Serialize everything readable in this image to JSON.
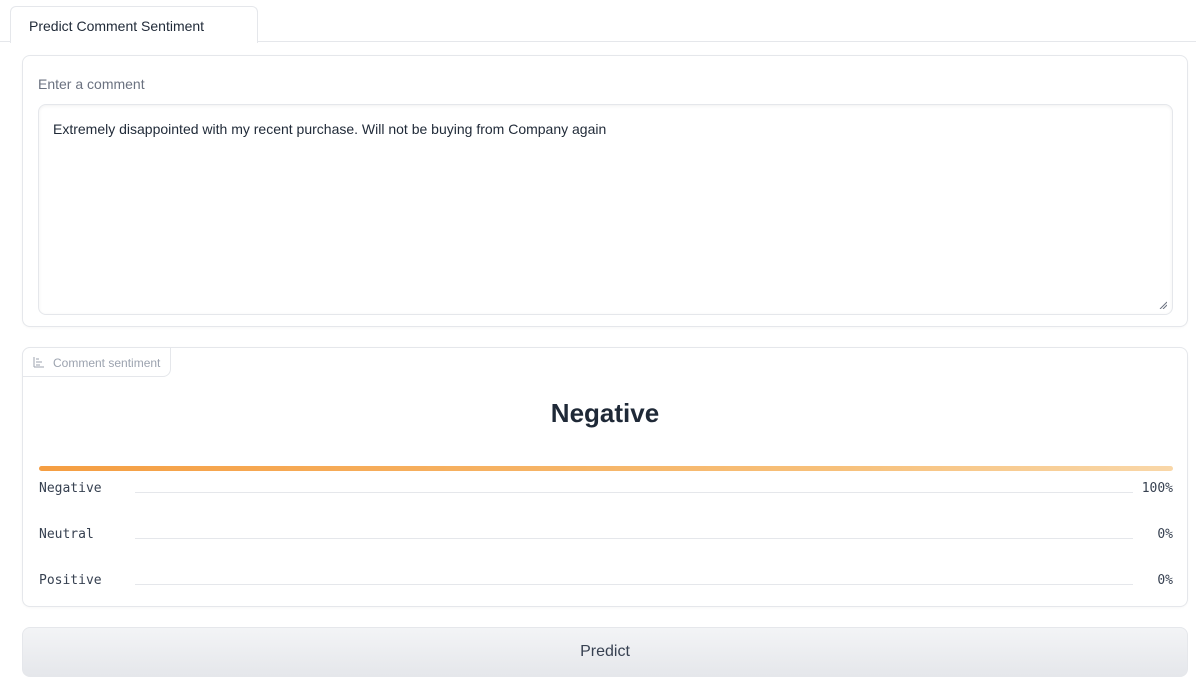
{
  "tabs": [
    {
      "label": "Predict Comment Sentiment"
    }
  ],
  "input": {
    "label": "Enter a comment",
    "value": "Extremely disappointed with my recent purchase. Will not be buying from Company again"
  },
  "output": {
    "label": "Comment sentiment",
    "label_icon": "bar-chart-icon",
    "top_label": "Negative",
    "confidences": [
      {
        "name": "Negative",
        "value": "100%",
        "fraction": 1.0
      },
      {
        "name": "Neutral",
        "value": "0%",
        "fraction": 0.0
      },
      {
        "name": "Positive",
        "value": "0%",
        "fraction": 0.0
      }
    ],
    "bar_color": "#f59e42"
  },
  "actions": {
    "predict_label": "Predict"
  }
}
